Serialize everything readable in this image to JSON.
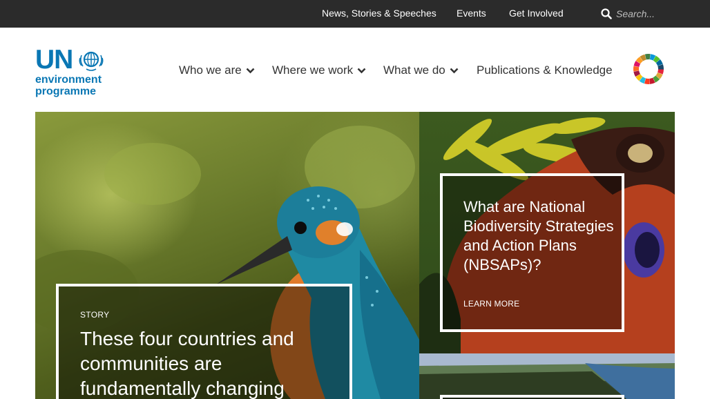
{
  "topbar": {
    "links": [
      "News, Stories & Speeches",
      "Events",
      "Get Involved"
    ],
    "search_placeholder": "Search..."
  },
  "logo": {
    "line1": "UN",
    "line2": "environment",
    "line3": "programme"
  },
  "nav": {
    "items": [
      {
        "label": "Who we are",
        "has_dropdown": true
      },
      {
        "label": "Where we work",
        "has_dropdown": true
      },
      {
        "label": "What we do",
        "has_dropdown": true
      },
      {
        "label": "Publications & Knowledge",
        "has_dropdown": false
      }
    ]
  },
  "hero": {
    "main": {
      "kicker": "STORY",
      "headline": "These four countries and communities are fundamentally changing"
    },
    "right_top": {
      "headline": "What are National Biodiversity Strategies and Action Plans (NBSAPs)?",
      "link": "LEARN MORE"
    }
  },
  "colors": {
    "topbar_bg": "#2b2b2b",
    "brand_blue": "#0a77b4",
    "nav_text": "#333333"
  },
  "icons": [
    "search-icon",
    "chevron-down-icon",
    "un-emblem-icon",
    "sdg-wheel-icon"
  ]
}
